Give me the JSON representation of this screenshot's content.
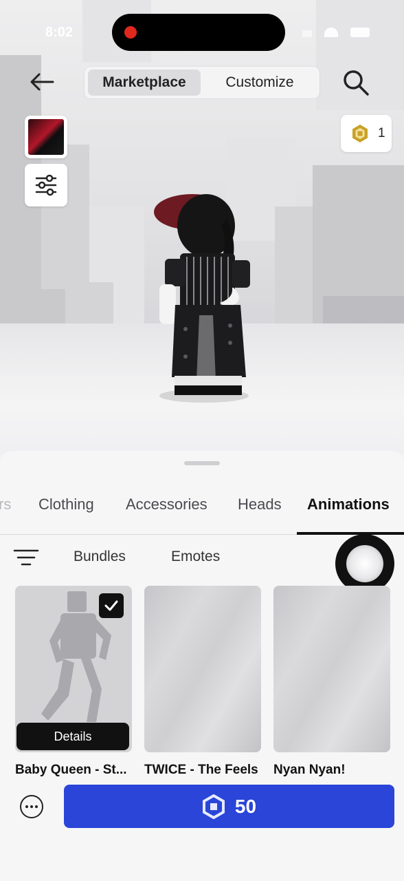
{
  "status_bar": {
    "time": "8:02"
  },
  "header": {
    "tabs": [
      {
        "label": "Marketplace",
        "active": true
      },
      {
        "label": "Customize",
        "active": false
      }
    ]
  },
  "robux_balance": {
    "value": "1"
  },
  "categories": [
    {
      "label": "rs",
      "active": false
    },
    {
      "label": "Clothing",
      "active": false
    },
    {
      "label": "Accessories",
      "active": false
    },
    {
      "label": "Heads",
      "active": false
    },
    {
      "label": "Animations",
      "active": true
    }
  ],
  "subcategories": [
    {
      "label": "Bundles"
    },
    {
      "label": "Emotes"
    }
  ],
  "items": [
    {
      "name": "Baby Queen - St...",
      "selected": true,
      "details_label": "Details"
    },
    {
      "name": "TWICE - The Feels",
      "selected": false
    },
    {
      "name": "Nyan Nyan!",
      "selected": false
    }
  ],
  "buy_button": {
    "price": "50"
  },
  "colors": {
    "accent_blue": "#2a45d8",
    "recording_red": "#e0281e",
    "robux_gold": "#c9a227"
  }
}
